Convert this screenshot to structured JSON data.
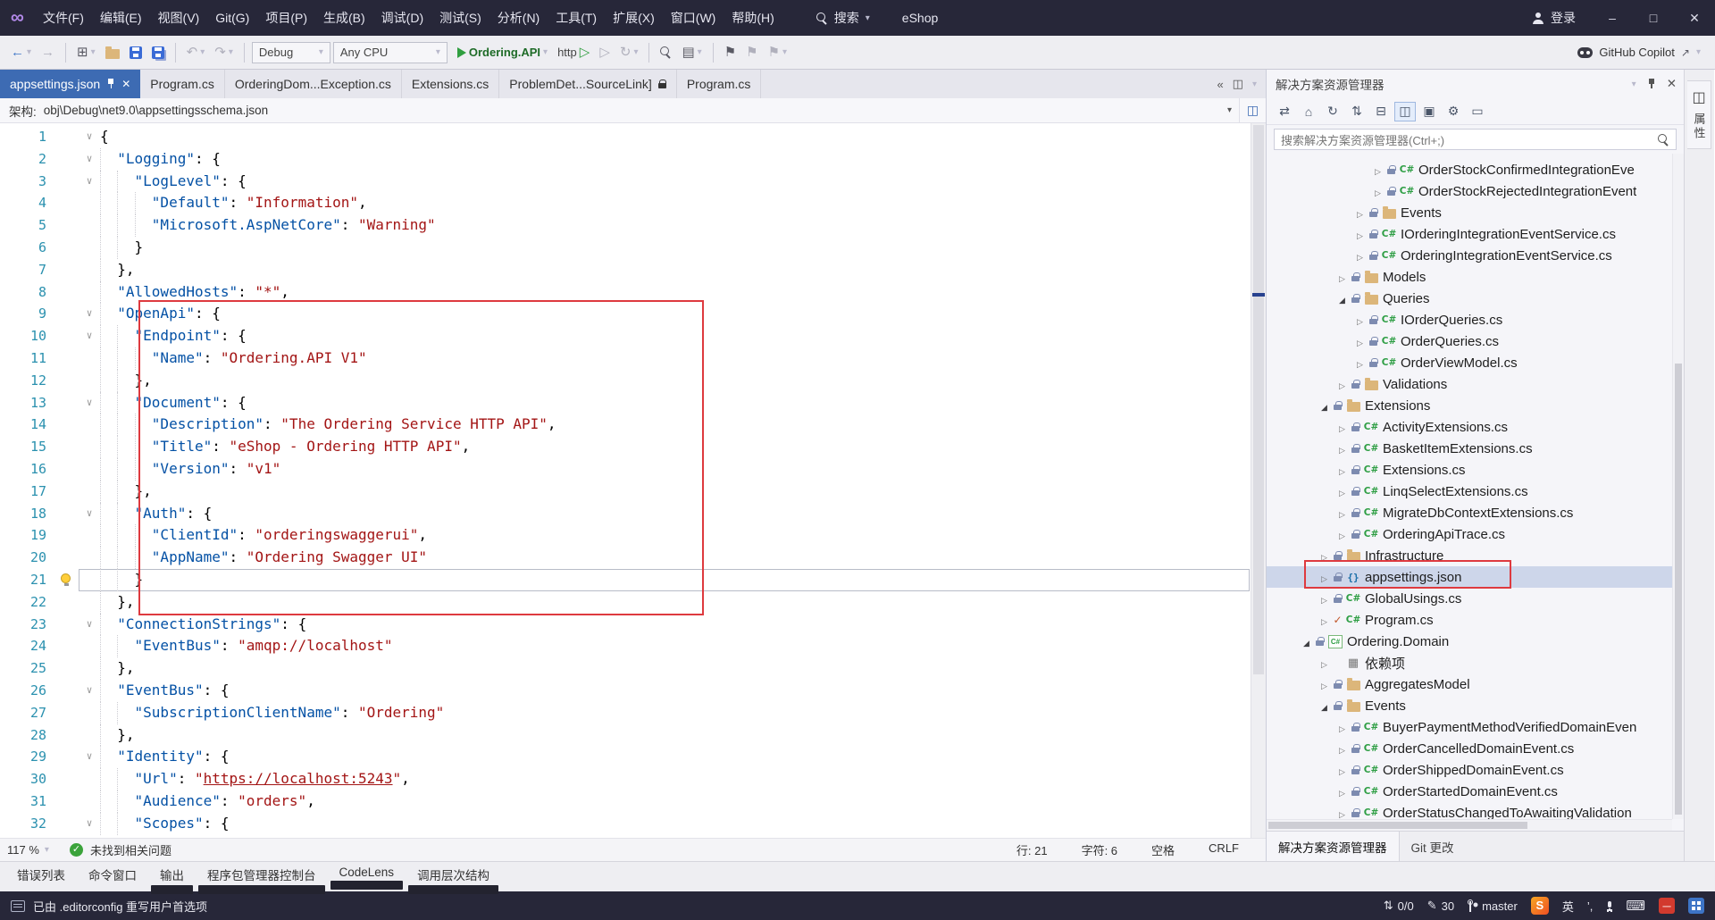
{
  "colors": {
    "accent": "#3d6bb3",
    "annotation": "#de3a3f",
    "dark_bar": "#272739",
    "key": "#0451a5",
    "string": "#a31515",
    "line_number": "#2b91af",
    "run_green": "#2f9e3f"
  },
  "icons": {
    "fold": "∨",
    "chev_r": "▷",
    "chev_d": "◢",
    "caret": "▾",
    "back": "←",
    "forward": "→",
    "undo": "↶",
    "redo": "↷",
    "play_outline": "▷",
    "restart": "↻",
    "double_chevron": "«",
    "menu": "▤",
    "flag": "⚑",
    "gear": "⚙",
    "min": "–",
    "max": "□",
    "close": "✕",
    "home": "⌂",
    "sync": "⇄",
    "swap": "⇅",
    "collapse": "⊟",
    "panes": "◫",
    "grid": "▣",
    "rect": "▭",
    "keyboard": "⌨",
    "updown": "⇅",
    "pencil": "✎",
    "newitem": "⊞",
    "external": "↗",
    "dots": "⋯",
    "dep": "▦"
  },
  "titlebar": {
    "search_label": "搜索",
    "solution": "eShop",
    "signin": "登录",
    "menus": [
      "文件(F)",
      "编辑(E)",
      "视图(V)",
      "Git(G)",
      "项目(P)",
      "生成(B)",
      "调试(D)",
      "测试(S)",
      "分析(N)",
      "工具(T)",
      "扩展(X)",
      "窗口(W)",
      "帮助(H)"
    ]
  },
  "toolbar": {
    "config": "Debug",
    "platform": "Any CPU",
    "profile": "Ordering.API",
    "launch": "http",
    "copilot": "GitHub Copilot"
  },
  "editor": {
    "tabs": [
      {
        "label": "appsettings.json",
        "active": true,
        "pinned": true
      },
      {
        "label": "Program.cs"
      },
      {
        "label": "OrderingDom...Exception.cs"
      },
      {
        "label": "Extensions.cs"
      },
      {
        "label": "ProblemDet...SourceLink]",
        "locked": true
      },
      {
        "label": "Program.cs"
      }
    ],
    "breadcrumb": {
      "label": "架构:",
      "value": "obj\\Debug\\net9.0\\appsettingsschema.json"
    },
    "status": {
      "zoom": "117 %",
      "issues": "未找到相关问题",
      "line": "行: 21",
      "col": "字符: 6",
      "space": "空格",
      "eol": "CRLF"
    },
    "lines": [
      {
        "n": 1,
        "ind": 0,
        "fold": true,
        "segs": [
          [
            "p",
            "{"
          ]
        ]
      },
      {
        "n": 2,
        "ind": 1,
        "fold": true,
        "segs": [
          [
            "k",
            "\"Logging\""
          ],
          [
            "p",
            ": {"
          ]
        ]
      },
      {
        "n": 3,
        "ind": 2,
        "fold": true,
        "segs": [
          [
            "k",
            "\"LogLevel\""
          ],
          [
            "p",
            ": {"
          ]
        ]
      },
      {
        "n": 4,
        "ind": 3,
        "segs": [
          [
            "k",
            "\"Default\""
          ],
          [
            "p",
            ": "
          ],
          [
            "s",
            "\"Information\""
          ],
          [
            "p",
            ","
          ]
        ]
      },
      {
        "n": 5,
        "ind": 3,
        "segs": [
          [
            "k",
            "\"Microsoft.AspNetCore\""
          ],
          [
            "p",
            ": "
          ],
          [
            "s",
            "\"Warning\""
          ]
        ]
      },
      {
        "n": 6,
        "ind": 2,
        "segs": [
          [
            "p",
            "}"
          ]
        ]
      },
      {
        "n": 7,
        "ind": 1,
        "segs": [
          [
            "p",
            "},"
          ]
        ]
      },
      {
        "n": 8,
        "ind": 1,
        "segs": [
          [
            "k",
            "\"AllowedHosts\""
          ],
          [
            "p",
            ": "
          ],
          [
            "s",
            "\"*\""
          ],
          [
            "p",
            ","
          ]
        ]
      },
      {
        "n": 9,
        "ind": 1,
        "fold": true,
        "segs": [
          [
            "k",
            "\"OpenApi\""
          ],
          [
            "p",
            ": {"
          ]
        ]
      },
      {
        "n": 10,
        "ind": 2,
        "fold": true,
        "segs": [
          [
            "k",
            "\"Endpoint\""
          ],
          [
            "p",
            ": {"
          ]
        ]
      },
      {
        "n": 11,
        "ind": 3,
        "segs": [
          [
            "k",
            "\"Name\""
          ],
          [
            "p",
            ": "
          ],
          [
            "s",
            "\"Ordering.API V1\""
          ]
        ]
      },
      {
        "n": 12,
        "ind": 2,
        "segs": [
          [
            "p",
            "},"
          ]
        ]
      },
      {
        "n": 13,
        "ind": 2,
        "fold": true,
        "segs": [
          [
            "k",
            "\"Document\""
          ],
          [
            "p",
            ": {"
          ]
        ]
      },
      {
        "n": 14,
        "ind": 3,
        "segs": [
          [
            "k",
            "\"Description\""
          ],
          [
            "p",
            ": "
          ],
          [
            "s",
            "\"The Ordering Service HTTP API\""
          ],
          [
            "p",
            ","
          ]
        ]
      },
      {
        "n": 15,
        "ind": 3,
        "segs": [
          [
            "k",
            "\"Title\""
          ],
          [
            "p",
            ": "
          ],
          [
            "s",
            "\"eShop - Ordering HTTP API\""
          ],
          [
            "p",
            ","
          ]
        ]
      },
      {
        "n": 16,
        "ind": 3,
        "segs": [
          [
            "k",
            "\"Version\""
          ],
          [
            "p",
            ": "
          ],
          [
            "s",
            "\"v1\""
          ]
        ]
      },
      {
        "n": 17,
        "ind": 2,
        "segs": [
          [
            "p",
            "},"
          ]
        ]
      },
      {
        "n": 18,
        "ind": 2,
        "fold": true,
        "segs": [
          [
            "k",
            "\"Auth\""
          ],
          [
            "p",
            ": {"
          ]
        ]
      },
      {
        "n": 19,
        "ind": 3,
        "segs": [
          [
            "k",
            "\"ClientId\""
          ],
          [
            "p",
            ": "
          ],
          [
            "s",
            "\"orderingswaggerui\""
          ],
          [
            "p",
            ","
          ]
        ]
      },
      {
        "n": 20,
        "ind": 3,
        "segs": [
          [
            "k",
            "\"AppName\""
          ],
          [
            "p",
            ": "
          ],
          [
            "s",
            "\"Ordering Swagger UI\""
          ]
        ]
      },
      {
        "n": 21,
        "ind": 2,
        "cur": true,
        "bulb": true,
        "segs": [
          [
            "p",
            "}"
          ]
        ]
      },
      {
        "n": 22,
        "ind": 1,
        "segs": [
          [
            "p",
            "},"
          ]
        ]
      },
      {
        "n": 23,
        "ind": 1,
        "fold": true,
        "segs": [
          [
            "k",
            "\"ConnectionStrings\""
          ],
          [
            "p",
            ": {"
          ]
        ]
      },
      {
        "n": 24,
        "ind": 2,
        "segs": [
          [
            "k",
            "\"EventBus\""
          ],
          [
            "p",
            ": "
          ],
          [
            "s",
            "\"amqp://localhost\""
          ]
        ]
      },
      {
        "n": 25,
        "ind": 1,
        "segs": [
          [
            "p",
            "},"
          ]
        ]
      },
      {
        "n": 26,
        "ind": 1,
        "fold": true,
        "segs": [
          [
            "k",
            "\"EventBus\""
          ],
          [
            "p",
            ": {"
          ]
        ]
      },
      {
        "n": 27,
        "ind": 2,
        "segs": [
          [
            "k",
            "\"SubscriptionClientName\""
          ],
          [
            "p",
            ": "
          ],
          [
            "s",
            "\"Ordering\""
          ]
        ]
      },
      {
        "n": 28,
        "ind": 1,
        "segs": [
          [
            "p",
            "},"
          ]
        ]
      },
      {
        "n": 29,
        "ind": 1,
        "fold": true,
        "segs": [
          [
            "k",
            "\"Identity\""
          ],
          [
            "p",
            ": {"
          ]
        ]
      },
      {
        "n": 30,
        "ind": 2,
        "segs": [
          [
            "k",
            "\"Url\""
          ],
          [
            "p",
            ": "
          ],
          [
            "s",
            "\""
          ],
          [
            "u",
            "https://localhost:5243"
          ],
          [
            "s",
            "\""
          ],
          [
            "p",
            ","
          ]
        ]
      },
      {
        "n": 31,
        "ind": 2,
        "segs": [
          [
            "k",
            "\"Audience\""
          ],
          [
            "p",
            ": "
          ],
          [
            "s",
            "\"orders\""
          ],
          [
            "p",
            ","
          ]
        ]
      },
      {
        "n": 32,
        "ind": 2,
        "fold": true,
        "segs": [
          [
            "k",
            "\"Scopes\""
          ],
          [
            "p",
            ": {"
          ]
        ]
      }
    ]
  },
  "solution_explorer": {
    "title": "解决方案资源管理器",
    "search_placeholder": "搜索解决方案资源管理器(Ctrl+;)",
    "toolbar": [
      {
        "name": "sync",
        "icon": "sync"
      },
      {
        "name": "home",
        "icon": "home"
      },
      {
        "name": "refresh",
        "icon": "restart"
      },
      {
        "name": "sort",
        "icon": "swap"
      },
      {
        "name": "collapse-all",
        "icon": "collapse"
      },
      {
        "name": "track-active-item",
        "icon": "panes",
        "active": true
      },
      {
        "name": "show-all-files",
        "icon": "grid"
      },
      {
        "name": "settings",
        "icon": "gear"
      },
      {
        "name": "preview",
        "icon": "rect"
      }
    ],
    "items": [
      {
        "lvl": 5,
        "chev": "r",
        "pre": "lock",
        "icon": "cs",
        "label": "OrderStockConfirmedIntegrationEve"
      },
      {
        "lvl": 5,
        "chev": "r",
        "pre": "lock",
        "icon": "cs",
        "label": "OrderStockRejectedIntegrationEvent"
      },
      {
        "lvl": 4,
        "chev": "r",
        "pre": "lock",
        "icon": "folder",
        "label": "Events"
      },
      {
        "lvl": 4,
        "chev": "r",
        "pre": "lock",
        "icon": "cs",
        "label": "IOrderingIntegrationEventService.cs"
      },
      {
        "lvl": 4,
        "chev": "r",
        "pre": "lock",
        "icon": "cs",
        "label": "OrderingIntegrationEventService.cs"
      },
      {
        "lvl": 3,
        "chev": "r",
        "pre": "lock",
        "icon": "folder",
        "label": "Models"
      },
      {
        "lvl": 3,
        "chev": "d",
        "pre": "lock",
        "icon": "folder",
        "label": "Queries"
      },
      {
        "lvl": 4,
        "chev": "r",
        "pre": "lock",
        "icon": "cs",
        "label": "IOrderQueries.cs"
      },
      {
        "lvl": 4,
        "chev": "r",
        "pre": "lock",
        "icon": "cs",
        "label": "OrderQueries.cs"
      },
      {
        "lvl": 4,
        "chev": "r",
        "pre": "lock",
        "icon": "cs",
        "label": "OrderViewModel.cs"
      },
      {
        "lvl": 3,
        "chev": "r",
        "pre": "lock",
        "icon": "folder",
        "label": "Validations"
      },
      {
        "lvl": 2,
        "chev": "d",
        "pre": "lock",
        "icon": "folder",
        "label": "Extensions"
      },
      {
        "lvl": 3,
        "chev": "r",
        "pre": "lock",
        "icon": "cs",
        "label": "ActivityExtensions.cs"
      },
      {
        "lvl": 3,
        "chev": "r",
        "pre": "lock",
        "icon": "cs",
        "label": "BasketItemExtensions.cs"
      },
      {
        "lvl": 3,
        "chev": "r",
        "pre": "lock",
        "icon": "cs",
        "label": "Extensions.cs"
      },
      {
        "lvl": 3,
        "chev": "r",
        "pre": "lock",
        "icon": "cs",
        "label": "LinqSelectExtensions.cs"
      },
      {
        "lvl": 3,
        "chev": "r",
        "pre": "lock",
        "icon": "cs",
        "label": "MigrateDbContextExtensions.cs"
      },
      {
        "lvl": 3,
        "chev": "r",
        "pre": "lock",
        "icon": "cs",
        "label": "OrderingApiTrace.cs"
      },
      {
        "lvl": 2,
        "chev": "r",
        "pre": "lock",
        "icon": "folder",
        "label": "Infrastructure"
      },
      {
        "lvl": 2,
        "chev": "r",
        "pre": "lock",
        "icon": "json",
        "label": "appsettings.json",
        "selected": true
      },
      {
        "lvl": 2,
        "chev": "r",
        "pre": "lock",
        "icon": "cs",
        "label": "GlobalUsings.cs"
      },
      {
        "lvl": 2,
        "chev": "r",
        "pre": "check",
        "icon": "cs",
        "label": "Program.cs"
      },
      {
        "lvl": 1,
        "chev": "d",
        "pre": "lock",
        "icon": "proj",
        "label": "Ordering.Domain"
      },
      {
        "lvl": 2,
        "chev": "r",
        "pre": "",
        "icon": "dep",
        "label": "依赖项"
      },
      {
        "lvl": 2,
        "chev": "r",
        "pre": "lock",
        "icon": "folder",
        "label": "AggregatesModel"
      },
      {
        "lvl": 2,
        "chev": "d",
        "pre": "lock",
        "icon": "folder",
        "label": "Events"
      },
      {
        "lvl": 3,
        "chev": "r",
        "pre": "lock",
        "icon": "cs",
        "label": "BuyerPaymentMethodVerifiedDomainEven"
      },
      {
        "lvl": 3,
        "chev": "r",
        "pre": "lock",
        "icon": "cs",
        "label": "OrderCancelledDomainEvent.cs"
      },
      {
        "lvl": 3,
        "chev": "r",
        "pre": "lock",
        "icon": "cs",
        "label": "OrderShippedDomainEvent.cs"
      },
      {
        "lvl": 3,
        "chev": "r",
        "pre": "lock",
        "icon": "cs",
        "label": "OrderStartedDomainEvent.cs"
      },
      {
        "lvl": 3,
        "chev": "r",
        "pre": "lock",
        "icon": "cs",
        "label": "OrderStatusChangedToAwaitingValidation"
      }
    ],
    "bottom_tabs": [
      {
        "label": "解决方案资源管理器",
        "active": true
      },
      {
        "label": "Git 更改"
      }
    ]
  },
  "right_strip": {
    "label": "属性"
  },
  "bottom_panel": {
    "tabs": [
      {
        "label": "错误列表"
      },
      {
        "label": "命令窗口"
      },
      {
        "label": "输出",
        "dark": true
      },
      {
        "label": "程序包管理器控制台",
        "dark": true
      },
      {
        "label": "CodeLens",
        "dark": true
      },
      {
        "label": "调用层次结构",
        "dark": true
      }
    ]
  },
  "statusbar": {
    "message": "已由 .editorconfig 重写用户首选项",
    "sync": "0/0",
    "edits": "30",
    "branch": "master",
    "ime_lang": "英",
    "ime_punct": "’,"
  }
}
